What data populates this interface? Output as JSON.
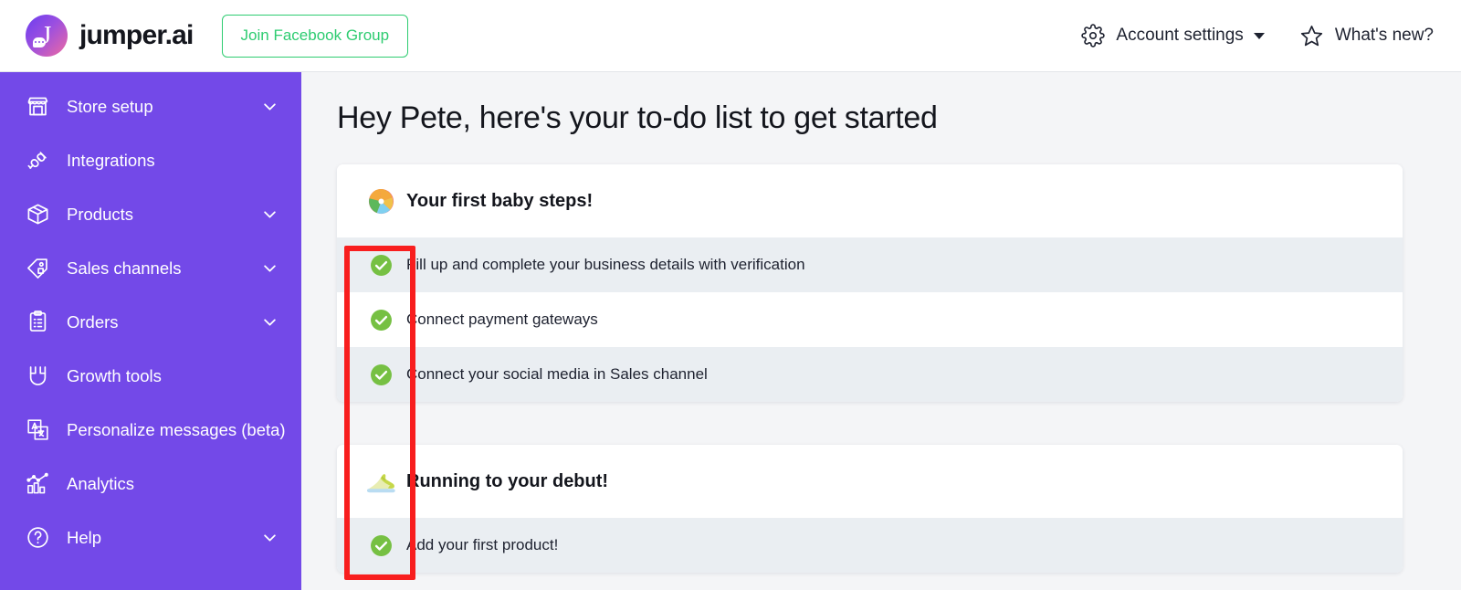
{
  "header": {
    "brand_name": "jumper.ai",
    "logo_glyph": "J",
    "logo_icon_name": "jumper-logo-chat-bubble",
    "facebook_button": "Join Facebook Group",
    "account_settings": "Account settings",
    "account_settings_icon": "gear-icon",
    "whats_new": "What's new?",
    "whats_new_icon": "star-icon"
  },
  "sidebar": {
    "background_color": "#7349e8",
    "items": [
      {
        "label": "Store setup",
        "icon": "storefront-icon",
        "has_chevron": true
      },
      {
        "label": "Integrations",
        "icon": "plug-icon",
        "has_chevron": false
      },
      {
        "label": "Products",
        "icon": "box-icon",
        "has_chevron": true
      },
      {
        "label": "Sales channels",
        "icon": "tag-icon",
        "has_chevron": true
      },
      {
        "label": "Orders",
        "icon": "clipboard-icon",
        "has_chevron": true
      },
      {
        "label": "Growth tools",
        "icon": "magnet-icon",
        "has_chevron": false
      },
      {
        "label": "Personalize messages (beta)",
        "icon": "translate-icon",
        "has_chevron": false
      },
      {
        "label": "Analytics",
        "icon": "bar-chart-icon",
        "has_chevron": false
      },
      {
        "label": "Help",
        "icon": "question-mark-circle-icon",
        "has_chevron": true
      }
    ]
  },
  "main": {
    "page_title": "Hey Pete, here's your to-do list to get started",
    "cards": [
      {
        "title": "Your first baby steps!",
        "icon": "beach-ball-emoji",
        "tasks": [
          {
            "label": "Fill up and complete your business details with verification",
            "status": "complete",
            "icon": "green-check-icon"
          },
          {
            "label": "Connect payment gateways",
            "status": "complete",
            "icon": "green-check-icon"
          },
          {
            "label": "Connect your social media in Sales channel",
            "status": "complete",
            "icon": "green-check-icon"
          }
        ]
      },
      {
        "title": "Running to your debut!",
        "icon": "running-shoe-emoji",
        "tasks": [
          {
            "label": "Add your first product!",
            "status": "complete",
            "icon": "green-check-icon"
          }
        ]
      }
    ]
  },
  "annotation": {
    "highlight_color": "#f81e1e",
    "description": "red rectangle around task status check column"
  },
  "colors": {
    "sidebar_purple": "#7349e8",
    "accent_green": "#76c043",
    "fb_button_green": "#2ecc71",
    "row_alt_bg": "#eaeef2",
    "page_bg": "#f4f5f7",
    "highlight_red": "#f81e1e"
  }
}
